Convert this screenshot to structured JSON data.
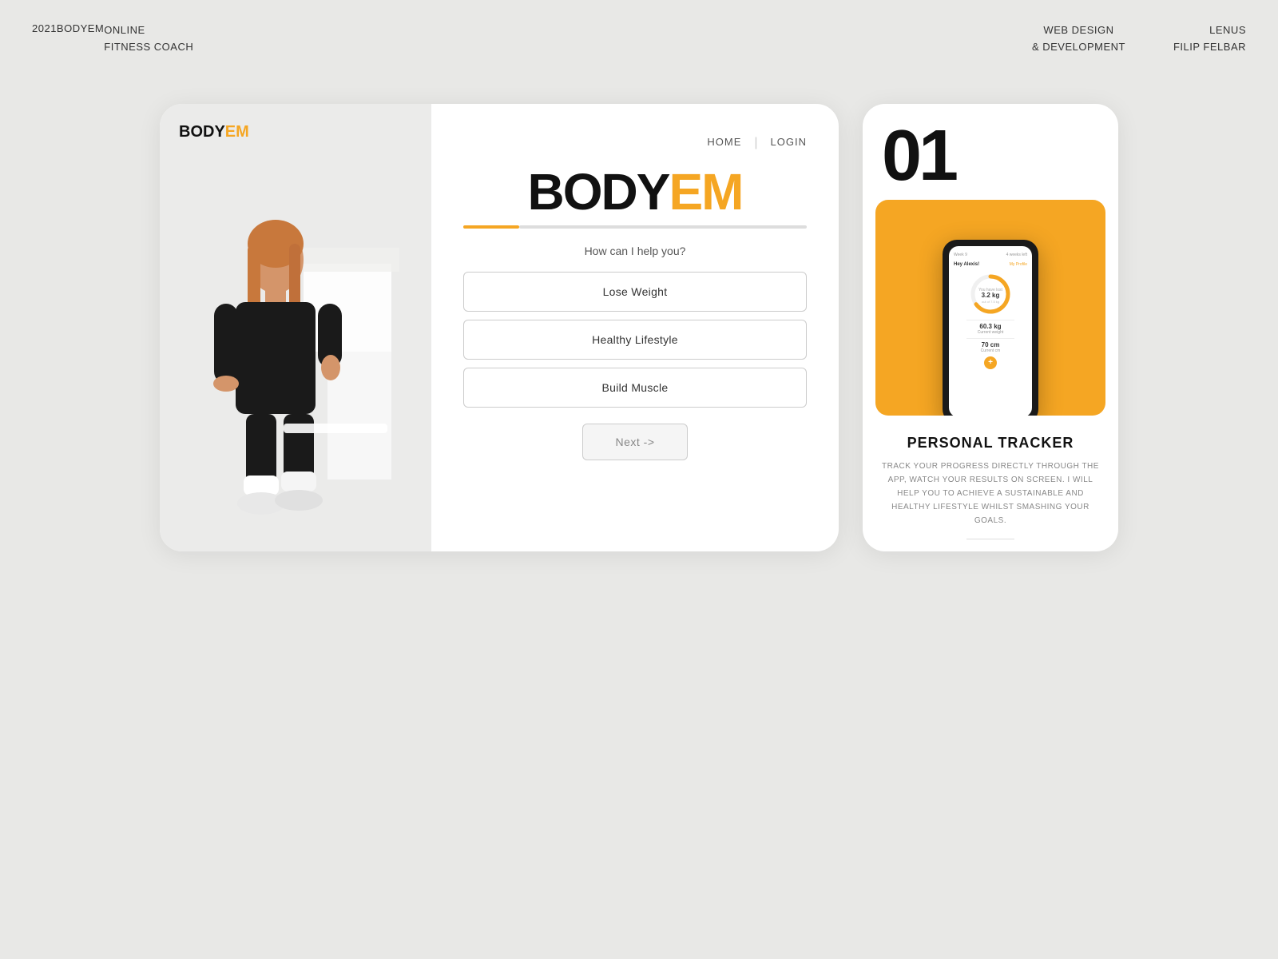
{
  "nav": {
    "year": "2021",
    "brand": "BODYEM",
    "subtitle_line1": "ONLINE",
    "subtitle_line2": "FITNESS COACH",
    "webdesign_line1": "WEB DESIGN",
    "webdesign_line2": "& DEVELOPMENT",
    "author_line1": "LENUS",
    "author_line2": "FILIP FELBAR"
  },
  "left_card": {
    "small_logo_body": "BODY",
    "small_logo_em": "EM",
    "nav_home": "HOME",
    "nav_login": "LOGIN",
    "logo_body": "BODY",
    "logo_em": "EM",
    "question": "How can I help you?",
    "options": [
      "Lose Weight",
      "Healthy Lifestyle",
      "Build Muscle"
    ],
    "next_btn": "Next ->"
  },
  "right_card": {
    "number": "01",
    "phone": {
      "week": "Week 9",
      "weeks_left": "4 weeks left",
      "greeting": "Hey Alexis!",
      "profile_link": "My Profile",
      "lost_label": "You have lost",
      "lost_value": "3.2 kg",
      "lost_of": "out of 7.5 kg",
      "weight_value": "60.3 kg",
      "weight_label": "Current weight",
      "cm_value": "70 cm",
      "cm_label": "Current cm"
    },
    "title": "PERSONAL TRACKER",
    "description": "TRACK YOUR PROGRESS DIRECTLY THROUGH THE APP, WATCH YOUR RESULTS ON SCREEN. I WILL HELP YOU TO ACHIEVE A SUSTAINABLE AND HEALTHY LIFESTYLE WHILST SMASHING YOUR GOALS."
  }
}
